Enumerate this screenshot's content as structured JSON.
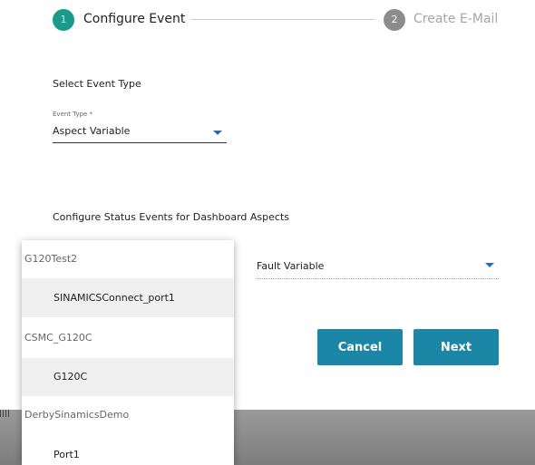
{
  "stepper": {
    "step1": {
      "number": "1",
      "label": "Configure Event"
    },
    "step2": {
      "number": "2",
      "label": "Create E-Mail"
    }
  },
  "event": {
    "section_title": "Select Event Type",
    "field_label": "Event Type *",
    "selected_value": "Aspect Variable"
  },
  "status": {
    "section_title": "Configure Status Events for Dashboard Aspects",
    "variable_value": "Fault Variable"
  },
  "buttons": {
    "cancel": "Cancel",
    "next": "Next"
  },
  "dropdown": {
    "groups": [
      {
        "label": "G120Test2",
        "options": [
          "SINAMICSConnect_port1"
        ]
      },
      {
        "label": "CSMC_G120C",
        "options": [
          "G120C"
        ]
      },
      {
        "label": "DerbySinamicsDemo",
        "options": [
          "Port1"
        ]
      }
    ]
  },
  "colors": {
    "accent": "#1c86a6",
    "active_step": "#1a9a8a",
    "inactive_step": "#8c8c8c"
  }
}
